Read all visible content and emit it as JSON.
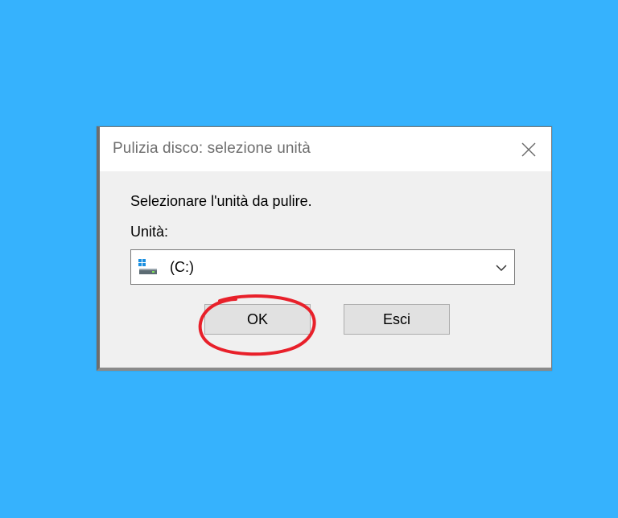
{
  "dialog": {
    "title": "Pulizia disco: selezione unità",
    "prompt": "Selezionare l'unità da pulire.",
    "drive_label": "Unità:",
    "drive_select": {
      "value": "(C:)",
      "icon": "drive-icon"
    },
    "buttons": {
      "ok": "OK",
      "cancel": "Esci"
    },
    "close_icon": "close-icon"
  },
  "colors": {
    "background": "#36b2fd",
    "annotation": "#e8202a",
    "dialog": "#f0f0f0",
    "button": "#e1e1e1"
  }
}
